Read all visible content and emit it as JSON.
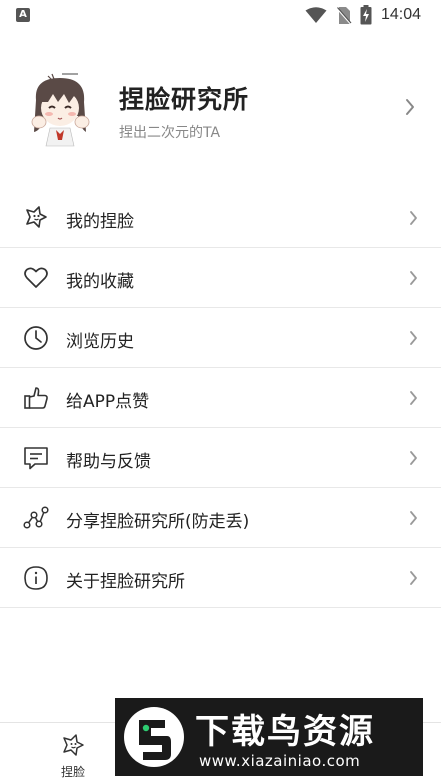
{
  "status_bar": {
    "notification_icon": "A",
    "time": "14:04",
    "icons": [
      "wifi-icon",
      "no-sim-icon",
      "battery-charging-icon"
    ]
  },
  "profile": {
    "name": "捏脸研究所",
    "slogan": "捏出二次元的TA",
    "avatar": "anime-girl-avatar"
  },
  "menu": {
    "items": [
      {
        "label": "我的捏脸",
        "icon": "face-sparkle-icon"
      },
      {
        "label": "我的收藏",
        "icon": "heart-icon"
      },
      {
        "label": "浏览历史",
        "icon": "clock-icon"
      },
      {
        "label": "给APP点赞",
        "icon": "thumbs-up-icon"
      },
      {
        "label": "帮助与反馈",
        "icon": "feedback-icon"
      },
      {
        "label": "分享捏脸研究所(防走丢)",
        "icon": "share-icon"
      },
      {
        "label": "关于捏脸研究所",
        "icon": "info-icon"
      }
    ]
  },
  "bottom_nav": {
    "tabs": [
      {
        "label": "捏脸",
        "icon": "face-sparkle-icon"
      }
    ]
  },
  "watermark": {
    "title": "下载鸟资源",
    "url": "www.xiazainiao.com"
  },
  "colors": {
    "text": "#222222",
    "secondary_text": "#888888",
    "divider": "#e8e8e8",
    "chevron": "#999999"
  }
}
